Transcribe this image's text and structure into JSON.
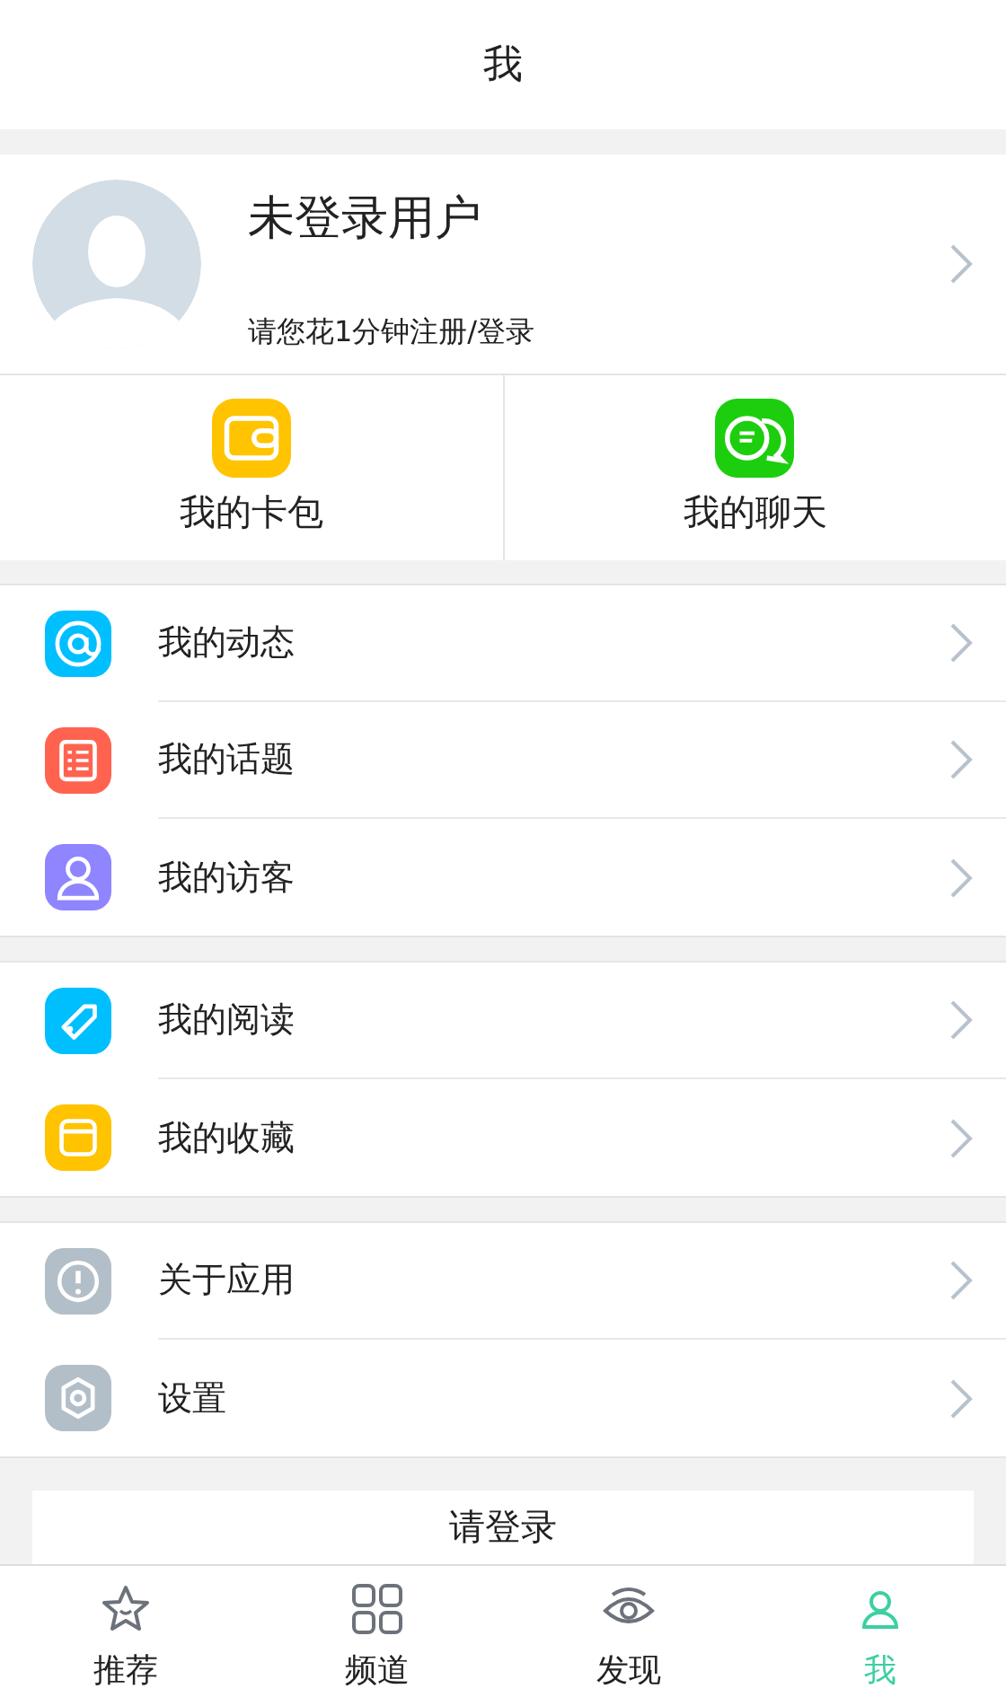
{
  "header": {
    "title": "我"
  },
  "profile": {
    "name": "未登录用户",
    "hint": "请您花1分钟注册/登录"
  },
  "shortcuts": [
    {
      "kind": "wallet",
      "label": "我的卡包",
      "color": "#ffc300"
    },
    {
      "kind": "chat",
      "label": "我的聊天",
      "color": "#1dce0e"
    }
  ],
  "groups": [
    {
      "items": [
        {
          "kind": "at",
          "label": "我的动态",
          "color": "#00bfff"
        },
        {
          "kind": "list",
          "label": "我的话题",
          "color": "#ff6350"
        },
        {
          "kind": "person",
          "label": "我的访客",
          "color": "#8e85ff"
        }
      ]
    },
    {
      "items": [
        {
          "kind": "tag",
          "label": "我的阅读",
          "color": "#00bfff"
        },
        {
          "kind": "box",
          "label": "我的收藏",
          "color": "#ffc300"
        }
      ]
    },
    {
      "items": [
        {
          "kind": "info",
          "label": "关于应用",
          "color": "#b3bfc8"
        },
        {
          "kind": "gear",
          "label": "设置",
          "color": "#b3bfc8"
        }
      ]
    }
  ],
  "login_button": "请登录",
  "tabs": [
    {
      "kind": "star",
      "label": "推荐",
      "selected": false
    },
    {
      "kind": "grid",
      "label": "频道",
      "selected": false
    },
    {
      "kind": "eye",
      "label": "发现",
      "selected": false
    },
    {
      "kind": "person",
      "label": "我",
      "selected": true
    }
  ]
}
